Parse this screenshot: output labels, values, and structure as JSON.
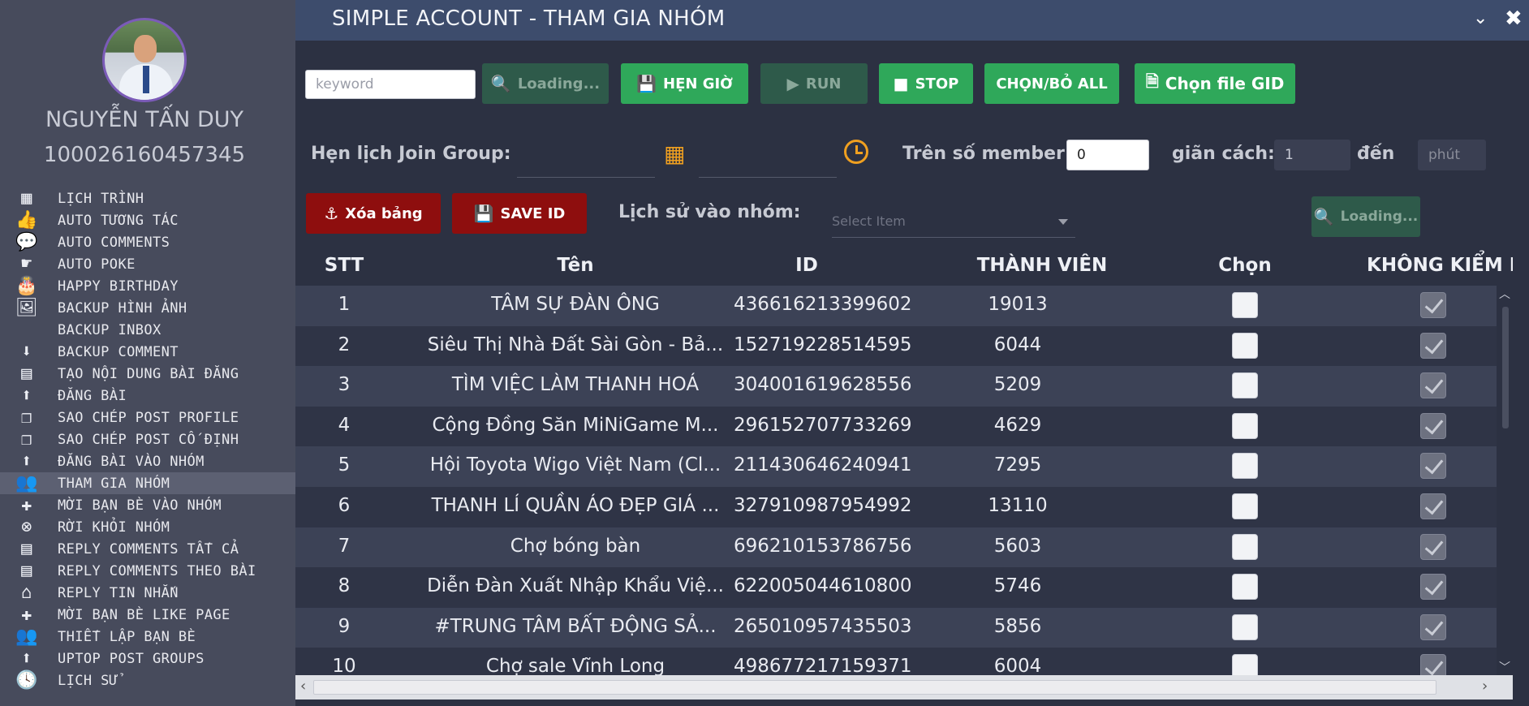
{
  "user": {
    "name": "NGUYỄN TẤN DUY",
    "id": "100026160457345"
  },
  "menu": [
    {
      "label": "LỊCH TRÌNH",
      "icon": "calendar-icon",
      "glyph": "▦"
    },
    {
      "label": "AUTO TƯƠNG TÁC",
      "icon": "thumbs-up-icon",
      "glyph": "👍"
    },
    {
      "label": "AUTO COMMENTS",
      "icon": "comment-icon",
      "glyph": "💬"
    },
    {
      "label": "AUTO POKE",
      "icon": "poke-hand-icon",
      "glyph": "☛"
    },
    {
      "label": "HAPPY BIRTHDAY",
      "icon": "birthday-cake-icon",
      "glyph": "🎂"
    },
    {
      "label": "BACKUP HÌNH ẢNH",
      "icon": "image-icon",
      "glyph": "🖼"
    },
    {
      "label": "BACKUP INBOX",
      "icon": "",
      "glyph": ""
    },
    {
      "label": "BACKUP COMMENT",
      "icon": "download-icon",
      "glyph": "⬇"
    },
    {
      "label": "TẠO NỘI DUNG BÀI ĐĂNG",
      "icon": "newspaper-icon",
      "glyph": "▤"
    },
    {
      "label": "ĐĂNG BÀI",
      "icon": "upload-icon",
      "glyph": "⬆"
    },
    {
      "label": "SAO CHÉP POST PROFILE",
      "icon": "copy-icon",
      "glyph": "❐"
    },
    {
      "label": "SAO CHÉP POST CỐ ĐỊNH",
      "icon": "copy-icon",
      "glyph": "❐"
    },
    {
      "label": "ĐĂNG BÀI VÀO NHÓM",
      "icon": "upload-icon",
      "glyph": "⬆"
    },
    {
      "label": "THAM GIA NHÓM",
      "icon": "group-icon",
      "glyph": "👥"
    },
    {
      "label": "MỜI BẠN BÈ VÀO NHÓM",
      "icon": "plus-icon",
      "glyph": "✚"
    },
    {
      "label": "RỜI KHỎI NHÓM",
      "icon": "remove-circle-icon",
      "glyph": "⊗"
    },
    {
      "label": "REPLY COMMENTS TẤT CẢ",
      "icon": "newspaper-icon",
      "glyph": "▤"
    },
    {
      "label": "REPLY COMMENTS THEO BÀI",
      "icon": "newspaper-icon",
      "glyph": "▤"
    },
    {
      "label": "REPLY TIN NHẮN",
      "icon": "inbox-icon",
      "glyph": "⌂"
    },
    {
      "label": "MỜI BẠN BÈ LIKE PAGE",
      "icon": "plus-icon",
      "glyph": "✚"
    },
    {
      "label": "THIẾT LẬP BẠN BÈ",
      "icon": "friends-icon",
      "glyph": "👥"
    },
    {
      "label": "UPTOP POST GROUPS",
      "icon": "arrow-up-circle-icon",
      "glyph": "⬆"
    },
    {
      "label": "LỊCH SỬ",
      "icon": "history-icon",
      "glyph": "🕓"
    }
  ],
  "window": {
    "title": "SIMPLE ACCOUNT - THAM GIA NHÓM"
  },
  "toolbar": {
    "keyword_placeholder": "keyword",
    "loading_label": "Loading...",
    "schedule_label": "HẸN GIỜ",
    "run_label": "RUN",
    "stop_label": "STOP",
    "select_all_label": "CHỌN/BỎ ALL",
    "choose_file_label": "Chọn file GID"
  },
  "schedule": {
    "label": "Hẹn lịch Join Group:",
    "member_label": "Trên số member:",
    "member_value": "0",
    "interval_label": "giãn cách:",
    "interval_value": "1",
    "to_label": "đến",
    "minutes_placeholder": "phút"
  },
  "actions": {
    "clear_label": "Xóa bảng",
    "save_label": "SAVE ID",
    "history_label": "Lịch sử vào nhóm:",
    "history_placeholder": "Select Item",
    "loading_label": "Loading..."
  },
  "table": {
    "headers": [
      "STT",
      "Tên",
      "ID",
      "THÀNH VIÊN",
      "Chọn",
      "KHÔNG KIỂM D"
    ],
    "rows": [
      {
        "stt": "1",
        "name": "TÂM SỰ ĐÀN ÔNG",
        "id": "436616213399602",
        "members": "19013",
        "selected": false,
        "no_check": true
      },
      {
        "stt": "2",
        "name": "Siêu Thị Nhà Đất Sài Gòn - Bả...",
        "id": "152719228514595",
        "members": "6044",
        "selected": false,
        "no_check": true
      },
      {
        "stt": "3",
        "name": "TÌM VIỆC LÀM THANH HOÁ",
        "id": "304001619628556",
        "members": "5209",
        "selected": false,
        "no_check": true
      },
      {
        "stt": "4",
        "name": "Cộng Đồng Săn MiNiGame M...",
        "id": "296152707733269",
        "members": "4629",
        "selected": false,
        "no_check": true
      },
      {
        "stt": "5",
        "name": "Hội Toyota Wigo Việt Nam (Cl...",
        "id": "211430646240941",
        "members": "7295",
        "selected": false,
        "no_check": true
      },
      {
        "stt": "6",
        "name": "THANH LÍ QUẦN ÁO ĐẸP GIÁ ...",
        "id": "327910987954992",
        "members": "13110",
        "selected": false,
        "no_check": true
      },
      {
        "stt": "7",
        "name": "Chợ bóng bàn",
        "id": "696210153786756",
        "members": "5603",
        "selected": false,
        "no_check": true
      },
      {
        "stt": "8",
        "name": "Diễn Đàn Xuất Nhập Khẩu Việ...",
        "id": "622005044610800",
        "members": "5746",
        "selected": false,
        "no_check": true
      },
      {
        "stt": "9",
        "name": "#TRUNG TÂM BẤT ĐỘNG SẢ...",
        "id": "265010957435503",
        "members": "5856",
        "selected": false,
        "no_check": true
      },
      {
        "stt": "10",
        "name": "Chợ sale Vĩnh Long",
        "id": "498677217159371",
        "members": "6004",
        "selected": false,
        "no_check": true
      }
    ]
  },
  "colors": {
    "sidebar": "#474b5c",
    "titlebar": "#3d4c6c",
    "green": "#2fa85a",
    "red": "#8e0e0e",
    "accent_orange": "#f0a020"
  }
}
